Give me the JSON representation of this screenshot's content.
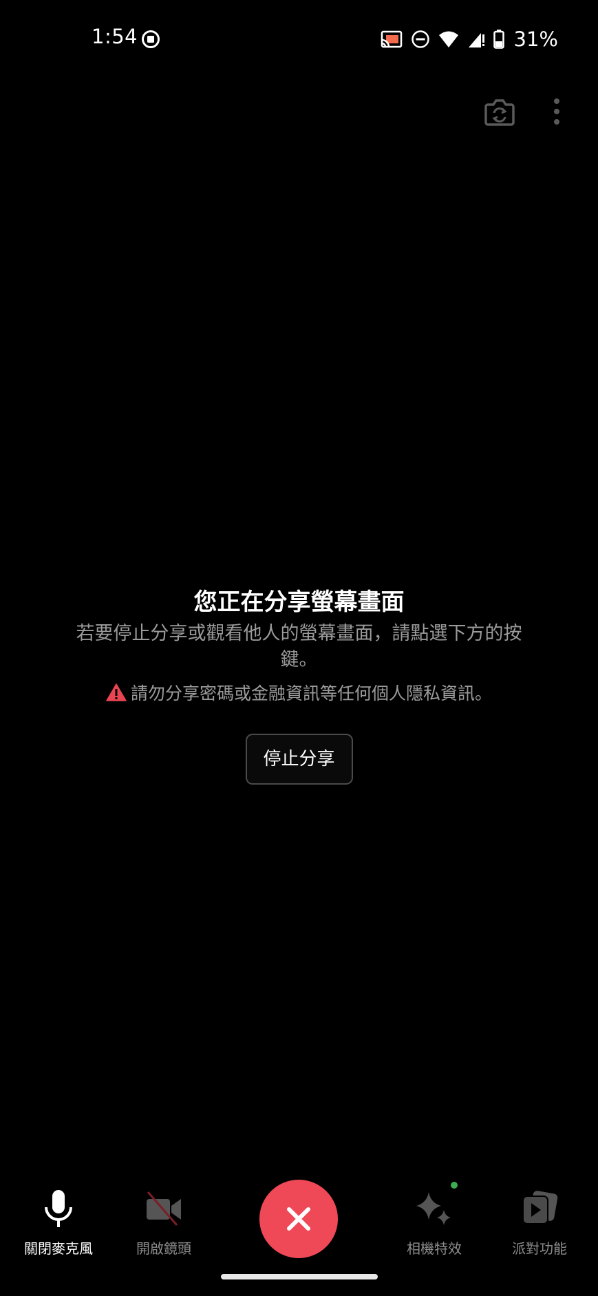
{
  "status_bar": {
    "time": "1:54",
    "battery_percent": "31%",
    "icons": [
      "screen-record-icon",
      "cast-icon",
      "dnd-icon",
      "wifi-icon",
      "signal-icon",
      "battery-icon"
    ]
  },
  "top_bar": {
    "icons": [
      "camera-switch-icon",
      "more-vert-icon"
    ]
  },
  "share_panel": {
    "title": "您正在分享螢幕畫面",
    "description": "若要停止分享或觀看他人的螢幕畫面，請點選下方的按鍵。",
    "warning": "請勿分享密碼或金融資訊等任何個人隱私資訊。",
    "stop_button_label": "停止分享"
  },
  "controls": {
    "mic_label": "關閉麥克風",
    "camera_label": "開啟鏡頭",
    "effects_label": "相機特效",
    "party_label": "派對功能"
  },
  "colors": {
    "background": "#000000",
    "end_call": "#ef4957",
    "warning_icon": "#e94452",
    "notification_dot": "#3cae52",
    "muted_text": "#9b9b9b"
  }
}
